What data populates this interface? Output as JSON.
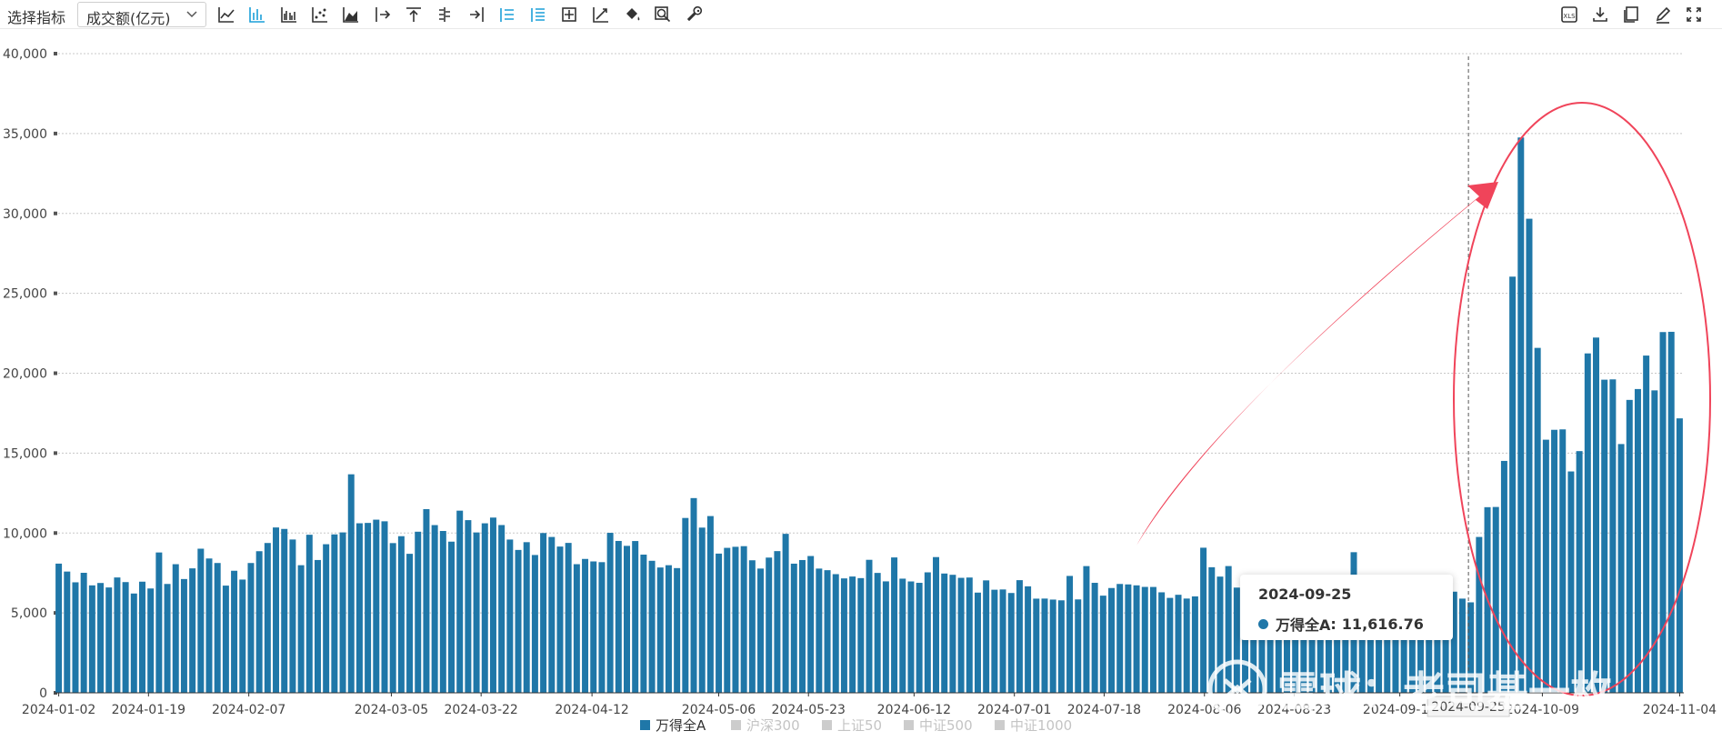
{
  "toolbar": {
    "label": "选择指标",
    "selected_indicator": "成交额(亿元)",
    "left_icons": [
      "line-chart-icon",
      "bar-chart-icon",
      "grouped-bar-icon",
      "scatter-icon",
      "area-chart-icon",
      "range-start-icon",
      "align-top-icon",
      "grid-lines-icon",
      "range-end-icon",
      "list-active-icon",
      "list-icon",
      "crosshair-icon",
      "trend-icon",
      "fill-icon",
      "zoom-icon",
      "settings-wrench-icon"
    ],
    "right_icons": [
      "xls-export-icon",
      "download-icon",
      "copy-icon",
      "edit-icon",
      "fullscreen-icon"
    ],
    "xls_text": "XLS"
  },
  "chart_data": {
    "type": "bar",
    "ylim": [
      0,
      40000
    ],
    "yticks": [
      "0",
      "5,000",
      "10,000",
      "15,000",
      "20,000",
      "25,000",
      "30,000",
      "35,000",
      "40,000"
    ],
    "xtick_labels": [
      "2024-01-02",
      "2024-01-19",
      "2024-02-07",
      "2024-03-05",
      "2024-03-22",
      "2024-04-12",
      "2024-05-06",
      "2024-05-23",
      "2024-06-12",
      "2024-07-01",
      "2024-07-18",
      "2024-08-06",
      "2024-08-23",
      "2024-09-12",
      "2024-10-09",
      "2024-11-04"
    ],
    "x_start": "2024-01-02",
    "x_end": "2024-11-04",
    "grid": true,
    "legend_position": "bottom",
    "colors": {
      "bar": "#1f77a8",
      "legend_inactive": "#cccccc",
      "annotation": "#f0445a"
    },
    "series": [
      {
        "name": "万得全A",
        "active": true,
        "values": [
          8085,
          7588,
          6915,
          7510,
          6724,
          6873,
          6593,
          7219,
          6929,
          6214,
          6955,
          6529,
          8783,
          6812,
          8049,
          7120,
          7788,
          9019,
          8406,
          8124,
          6709,
          7638,
          7087,
          8123,
          8862,
          9376,
          10348,
          10255,
          9594,
          7986,
          9893,
          8311,
          9299,
          9914,
          10038,
          13675,
          10610,
          10632,
          10835,
          10733,
          9369,
          9802,
          8699,
          10082,
          11496,
          10496,
          10128,
          9460,
          11399,
          10806,
          10035,
          10608,
          10967,
          10499,
          9591,
          8941,
          9427,
          8625,
          9999,
          9753,
          9153,
          9381,
          8050,
          8378,
          8222,
          8176,
          10012,
          9504,
          9197,
          9498,
          8648,
          8262,
          7843,
          7986,
          7805,
          10942,
          12186,
          10339,
          11061,
          8712,
          9072,
          9138,
          9177,
          8294,
          7776,
          8463,
          8868,
          9949,
          8082,
          8309,
          8561,
          7775,
          7674,
          7426,
          7160,
          7278,
          7178,
          8323,
          7503,
          6974,
          8472,
          7144,
          6969,
          6883,
          7539,
          8494,
          7465,
          7386,
          7196,
          7215,
          6271,
          7036,
          6451,
          6468,
          6247,
          7050,
          6664,
          5893,
          5898,
          5835,
          5788,
          7315,
          5845,
          7930,
          6883,
          6081,
          6558,
          6812,
          6784,
          6725,
          6628,
          6624,
          6289,
          5941,
          6135,
          5899,
          6034,
          9081,
          7859,
          7273,
          7932,
          6585,
          5876,
          6227,
          5546,
          5542,
          5473,
          5386,
          5226,
          5166,
          5058,
          4975,
          5058,
          5123,
          6219,
          8800,
          6283,
          5547,
          5168,
          5111,
          5138,
          5079,
          4961,
          5219,
          5339,
          5227,
          5389,
          6329,
          5895,
          5662,
          9754,
          11617,
          11630,
          14513,
          26045,
          34753,
          29668,
          21586,
          15840,
          16459,
          16486,
          13853,
          15126,
          21240,
          22233,
          19595,
          19615,
          15568,
          18330,
          19010,
          21105,
          18927,
          22576,
          22592,
          17175
        ]
      },
      {
        "name": "沪深300",
        "active": false
      },
      {
        "name": "上证50",
        "active": false
      },
      {
        "name": "中证500",
        "active": false
      },
      {
        "name": "中证1000",
        "active": false
      }
    ]
  },
  "tooltip": {
    "date": "2024-09-25",
    "series_name": "万得全A",
    "value_text": "11,616.76"
  },
  "crosshair_label": "2024-09-25",
  "watermark": {
    "text": "雪球：老司基一枚"
  }
}
